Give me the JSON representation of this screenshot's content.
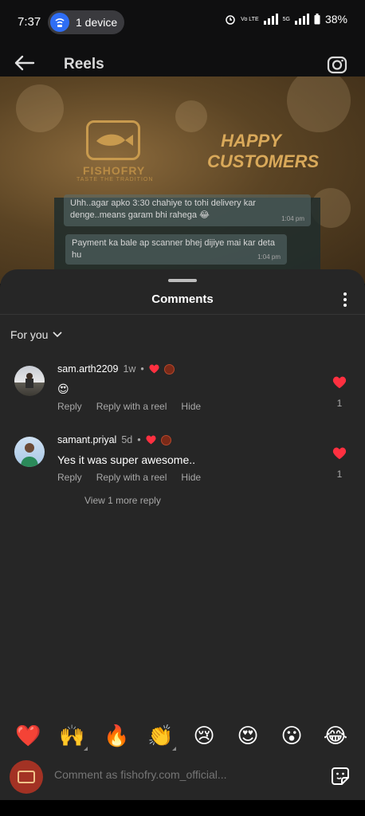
{
  "status_bar": {
    "time": "7:37",
    "device_label": "1 device",
    "network_label": "Vo LTE",
    "signal_label": "5G",
    "battery": "38%"
  },
  "header": {
    "title": "Reels",
    "back_icon": "back-arrow-icon",
    "camera_icon": "camera-icon"
  },
  "video": {
    "brand": "FISHOFRY",
    "tagline": "TASTE THE TRADITION",
    "headline_1": "HAPPY",
    "headline_2": "CUSTOMERS",
    "chat_message_1": "Uhh..agar apko 3:30 chahiye to tohi delivery kar denge..means garam bhi rahega 😂",
    "chat_time_1": "1:04 pm",
    "chat_message_2": "Payment ka bale ap scanner bhej dijiye mai kar deta hu",
    "chat_time_2": "1:04 pm"
  },
  "sheet": {
    "title": "Comments",
    "filter_label": "For you"
  },
  "comments": [
    {
      "username": "sam.arth2209",
      "ago": "1w",
      "text": "😍",
      "like_count": "1",
      "actions": [
        "Reply",
        "Reply with a reel",
        "Hide"
      ]
    },
    {
      "username": "samant.priyal",
      "ago": "5d",
      "text": "Yes it was super awesome..",
      "like_count": "1",
      "actions": [
        "Reply",
        "Reply with a reel",
        "Hide"
      ],
      "view_more": "View 1 more reply"
    }
  ],
  "reactions": [
    "❤️",
    "🙌",
    "🔥",
    "👏",
    "😢",
    "😍",
    "😮",
    "😂"
  ],
  "compose": {
    "placeholder": "Comment as fishofry.com_official..."
  },
  "colors": {
    "sheet_bg": "#262626",
    "heart_red": "#ff3040",
    "muted_text": "#a8a8a8"
  }
}
